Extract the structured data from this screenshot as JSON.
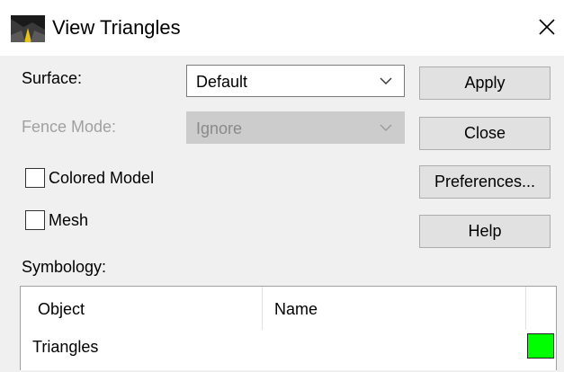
{
  "window": {
    "title": "View Triangles",
    "close_glyph": "×",
    "icon": "terrain-road-icon"
  },
  "form": {
    "surface": {
      "label": "Surface:",
      "value": "Default"
    },
    "fence_mode": {
      "label": "Fence Mode:",
      "value": "Ignore",
      "enabled": false
    },
    "colored_model": {
      "label": "Colored Model",
      "checked": false
    },
    "mesh": {
      "label": "Mesh",
      "checked": false
    },
    "symbology_label": "Symbology:"
  },
  "buttons": {
    "apply": "Apply",
    "close": "Close",
    "preferences": "Preferences...",
    "help": "Help"
  },
  "symbology": {
    "columns": [
      "Object",
      "Name",
      ""
    ],
    "rows": [
      {
        "object": "Triangles",
        "name": "",
        "color": "#00ff00"
      }
    ]
  },
  "colors": {
    "dialog_bg": "#f0f0f0",
    "button_bg": "#e1e1e1",
    "disabled_text": "#a0a0a0",
    "swatch_triangles": "#00ff00"
  }
}
